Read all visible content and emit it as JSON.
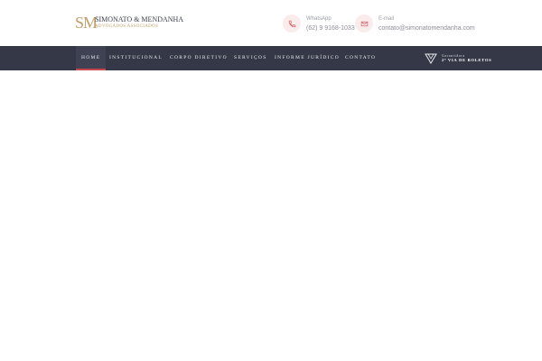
{
  "colors": {
    "nav_background": "#353947",
    "active_underline": "#c9474f",
    "brand_gold": "#c0a06a",
    "icon_accent": "#d2646b"
  },
  "header": {
    "logo": {
      "mark": "SM",
      "name": "SIMONATO & MENDANHA",
      "subtitle": "ADVOGADOS ASSOCIADOS"
    },
    "contacts": [
      {
        "icon": "phone-icon",
        "label": "WhatsApp",
        "value": "(62) 9 9168-1033"
      },
      {
        "icon": "mail-icon",
        "label": "E-mail",
        "value": "contato@simonatomendanha.com"
      }
    ]
  },
  "nav": {
    "items": [
      {
        "label": "HOME",
        "active": true
      },
      {
        "label": "INSTITUCIONAL",
        "active": false
      },
      {
        "label": "CORPO DIRETIVO",
        "active": false
      },
      {
        "label": "SERVIÇOS",
        "active": false
      },
      {
        "label": "INFORME JURÍDICO",
        "active": false
      },
      {
        "label": "CONTATO",
        "active": false
      }
    ],
    "boleto": {
      "icon": "triangle-logo-icon",
      "line1": "Garantidora",
      "line2": "2ª VIA DE BOLETOS"
    }
  }
}
